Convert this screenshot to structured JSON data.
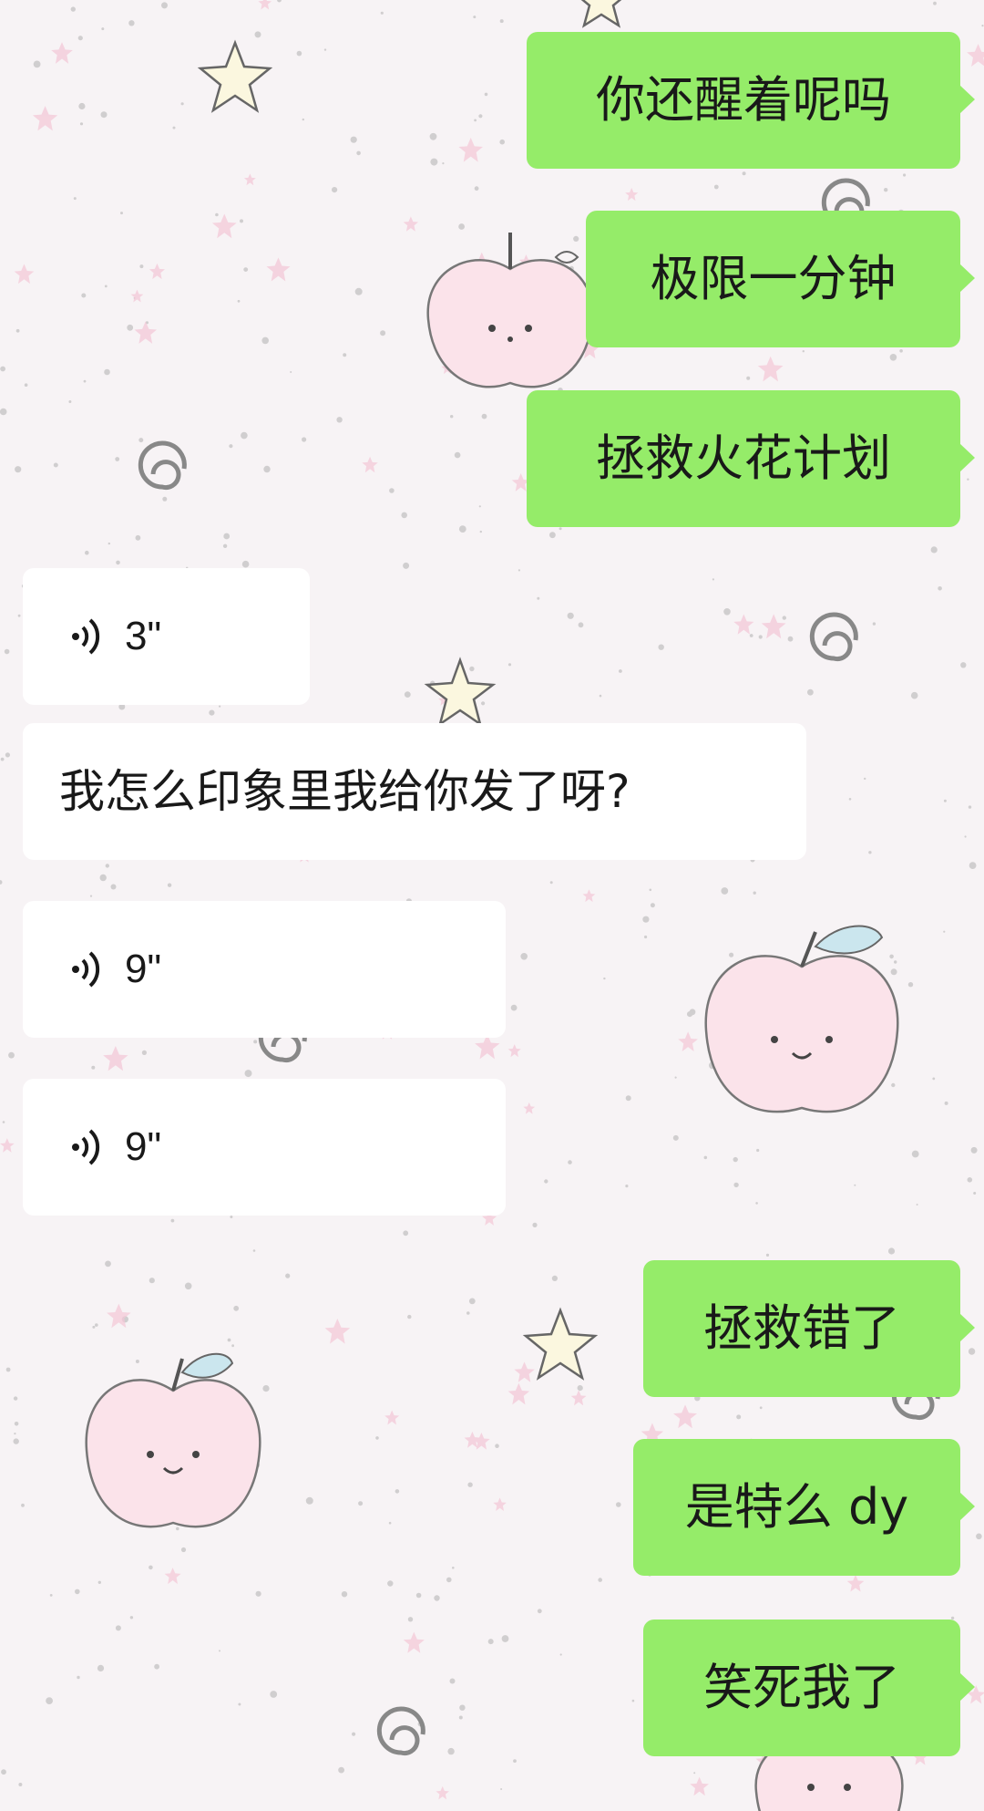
{
  "chat": {
    "messages": [
      {
        "type": "text",
        "direction": "outgoing",
        "text": "你还醒着呢吗"
      },
      {
        "type": "text",
        "direction": "outgoing",
        "text": "极限一分钟"
      },
      {
        "type": "text",
        "direction": "outgoing",
        "text": "拯救火花计划"
      },
      {
        "type": "voice",
        "direction": "incoming",
        "duration": "3\"",
        "icon": "voice-wave-icon"
      },
      {
        "type": "text",
        "direction": "incoming",
        "text": "我怎么印象里我给你发了呀?"
      },
      {
        "type": "voice",
        "direction": "incoming",
        "duration": "9\"",
        "icon": "voice-wave-icon"
      },
      {
        "type": "voice",
        "direction": "incoming",
        "duration": "9\"",
        "icon": "voice-wave-icon"
      },
      {
        "type": "text",
        "direction": "outgoing",
        "text": "拯救错了"
      },
      {
        "type": "text",
        "direction": "outgoing",
        "text": "是特么 dy"
      },
      {
        "type": "text",
        "direction": "outgoing",
        "text": "笑死我了"
      }
    ]
  },
  "colors": {
    "outgoing_bubble": "#95ec69",
    "incoming_bubble": "#ffffff",
    "text": "#191919",
    "wallpaper": "#f6f2f4"
  },
  "wallpaper": {
    "decorations": [
      "apple-icon",
      "star-icon",
      "swirl-icon",
      "dots-pattern"
    ]
  }
}
